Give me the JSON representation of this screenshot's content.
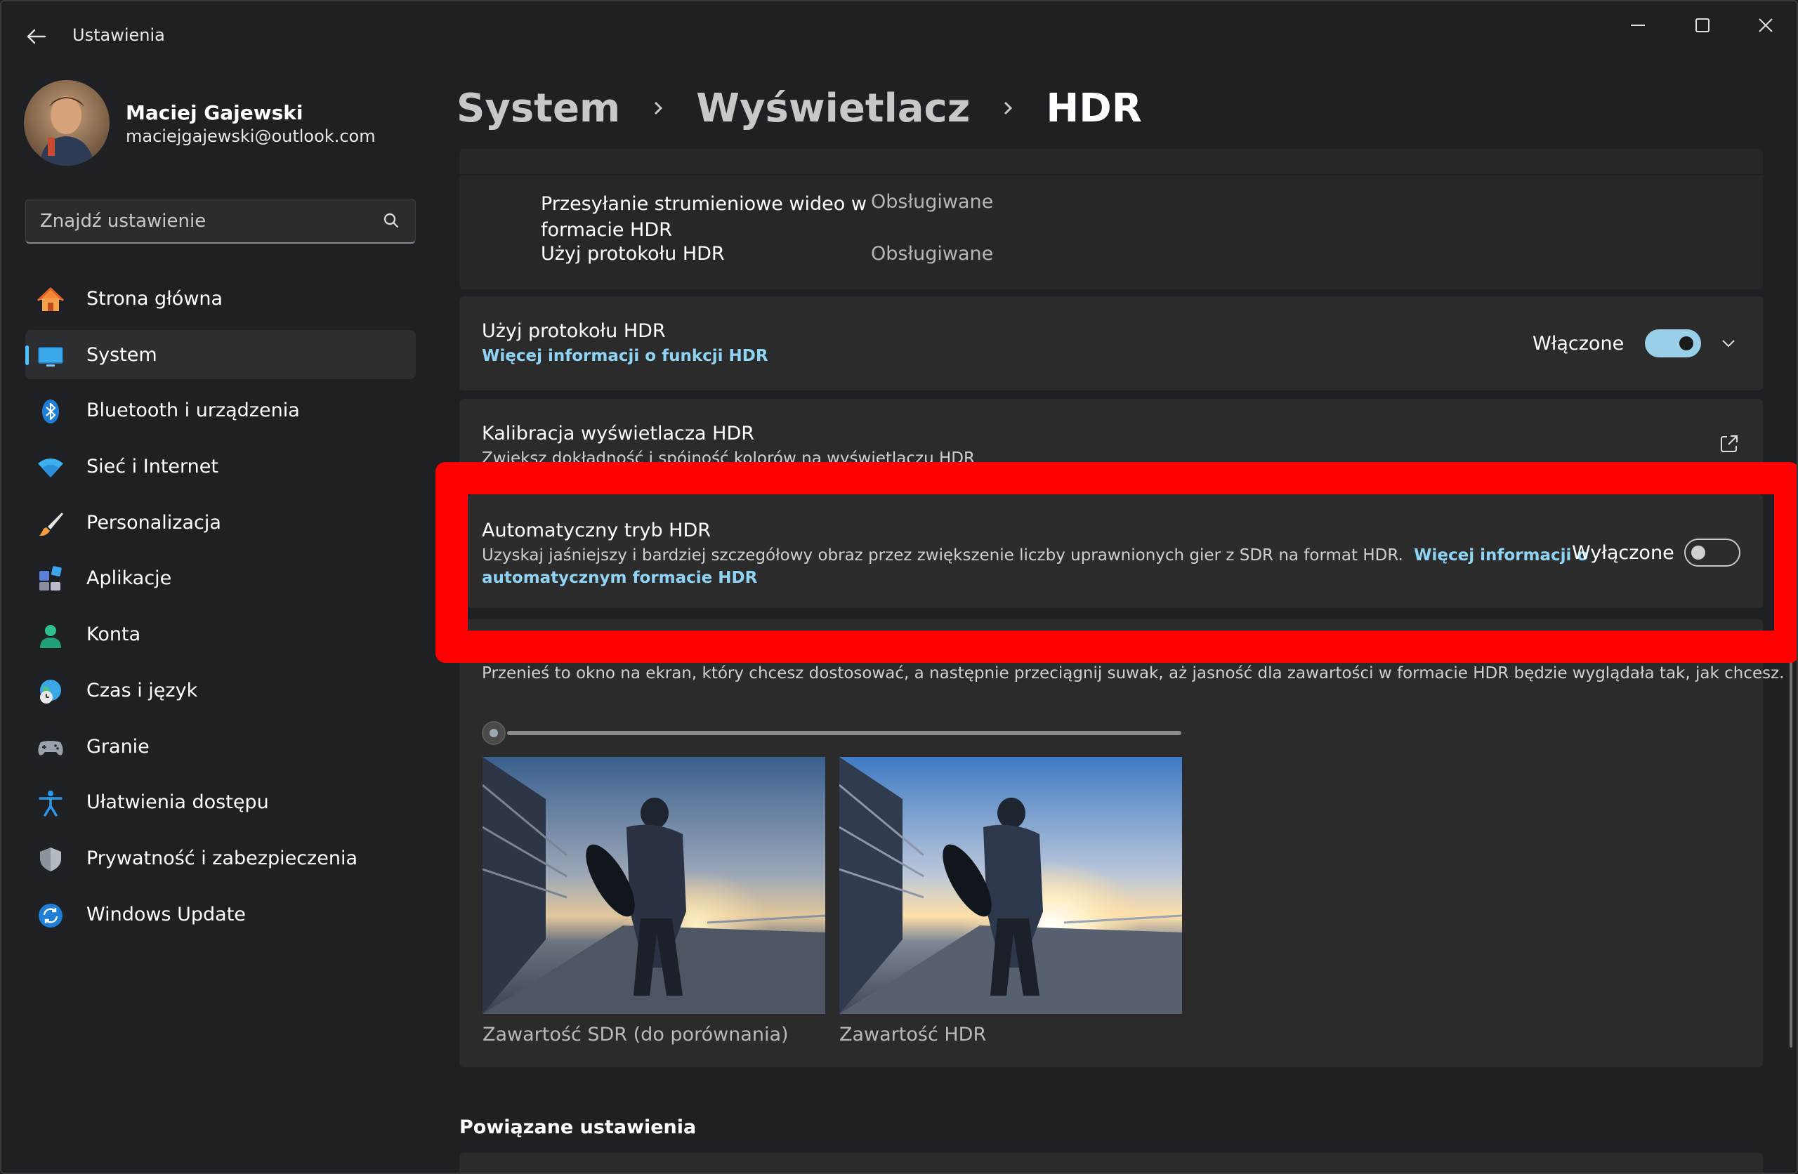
{
  "window": {
    "title": "Ustawienia"
  },
  "profile": {
    "name": "Maciej Gajewski",
    "email": "maciejgajewski@outlook.com"
  },
  "search": {
    "placeholder": "Znajdź ustawienie"
  },
  "nav": {
    "items": [
      {
        "label": "Strona główna",
        "icon": "home-icon",
        "active": false
      },
      {
        "label": "System",
        "icon": "monitor-icon",
        "active": true
      },
      {
        "label": "Bluetooth i urządzenia",
        "icon": "bluetooth-icon",
        "active": false
      },
      {
        "label": "Sieć i Internet",
        "icon": "wifi-icon",
        "active": false
      },
      {
        "label": "Personalizacja",
        "icon": "brush-icon",
        "active": false
      },
      {
        "label": "Aplikacje",
        "icon": "apps-icon",
        "active": false
      },
      {
        "label": "Konta",
        "icon": "person-icon",
        "active": false
      },
      {
        "label": "Czas i język",
        "icon": "globe-clock-icon",
        "active": false
      },
      {
        "label": "Granie",
        "icon": "gamepad-icon",
        "active": false
      },
      {
        "label": "Ułatwienia dostępu",
        "icon": "accessibility-icon",
        "active": false
      },
      {
        "label": "Prywatność i zabezpieczenia",
        "icon": "shield-icon",
        "active": false
      },
      {
        "label": "Windows Update",
        "icon": "update-icon",
        "active": false
      }
    ]
  },
  "breadcrumb": {
    "level1": "System",
    "level2": "Wyświetlacz",
    "current": "HDR"
  },
  "capabilities": {
    "row1": {
      "label": "Przesyłanie strumieniowe wideo w formacie HDR",
      "value": "Obsługiwane"
    },
    "row2": {
      "label": "Użyj protokołu HDR",
      "value": "Obsługiwane"
    }
  },
  "use_hdr": {
    "title": "Użyj protokołu HDR",
    "link": "Więcej informacji o funkcji HDR",
    "state": "Włączone",
    "on": true
  },
  "calibration": {
    "title": "Kalibracja wyświetlacza HDR",
    "subtitle": "Zwiększ dokładność i spójność kolorów na wyświetlaczu HDR"
  },
  "auto_hdr": {
    "title": "Automatyczny tryb HDR",
    "description": "Uzyskaj jaśniejszy i bardziej szczegółowy obraz przez zwiększenie liczby uprawnionych gier z SDR na format HDR.",
    "link_part1": "Więcej informacji o",
    "link_part2": "automatycznym formacie HDR",
    "state": "Wyłączone",
    "on": false
  },
  "brightness": {
    "instruction": "Przenieś to okno na ekran, który chcesz dostosować, a następnie przeciągnij suwak, aż jasność dla zawartości w formacie HDR będzie wyglądała tak, jak chcesz.",
    "slider_value": 0,
    "sdr_caption": "Zawartość SDR (do porównania)",
    "hdr_caption": "Zawartość HDR"
  },
  "related": {
    "title": "Powiązane ustawienia"
  },
  "colors": {
    "accent": "#4cc2ff",
    "toggle_on": "#99cfe8",
    "highlight": "#ff0000",
    "link": "#8fd3f5"
  }
}
